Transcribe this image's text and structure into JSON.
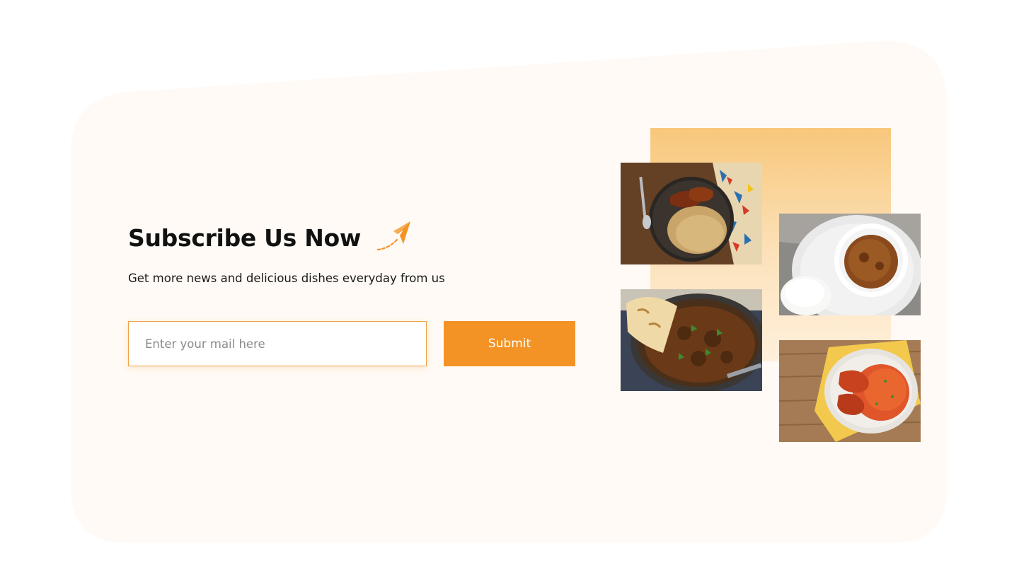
{
  "subscribe": {
    "title": "Subscribe Us Now",
    "subtitle": "Get more news and delicious dishes everyday from us",
    "email_placeholder": "Enter your mail here",
    "submit_label": "Submit"
  },
  "colors": {
    "accent": "#f39325",
    "background_blob": "#fffaf5",
    "panel": "#f8c77b"
  },
  "icons": {
    "title_icon": "paper-plane-icon"
  },
  "gallery": [
    {
      "name": "jollof-chicken-plate-photo"
    },
    {
      "name": "soup-with-fufu-photo"
    },
    {
      "name": "curry-skillet-with-naan-photo"
    },
    {
      "name": "jollof-rice-drumsticks-photo"
    }
  ]
}
